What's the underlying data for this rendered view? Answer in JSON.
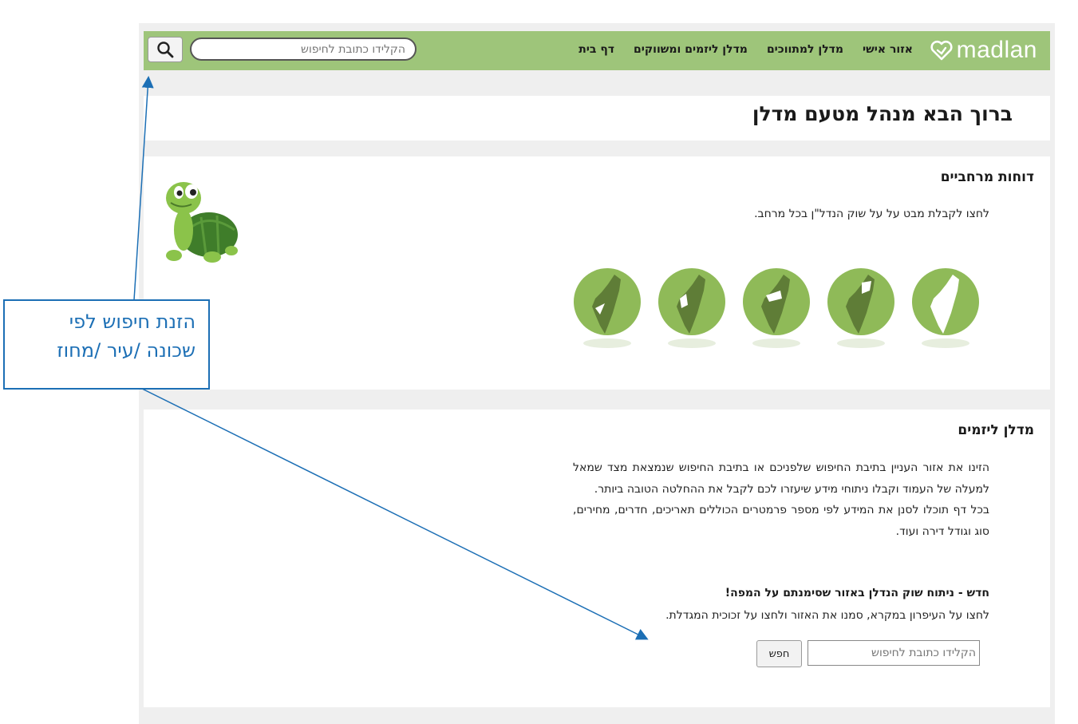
{
  "nav": {
    "logo_text": "madlan",
    "links": [
      "דף בית",
      "מדלן ליזמים ומשווקים",
      "מדלן למתווכים",
      "אזור אישי"
    ],
    "search_placeholder": "הקלידו כתובת לחיפוש"
  },
  "welcome": {
    "title": "ברוך הבא מנהל מטעם מדלן"
  },
  "regional": {
    "title": "דוחות מרחביים",
    "description": "לחצו לקבלת מבט על על שוק הנדל\"ן בכל מרחב."
  },
  "developers": {
    "title": "מדלן ליזמים",
    "paragraph1": "הזינו את אזור העניין בתיבת החיפוש שלפניכם או בתיבת החיפוש שנמצאת מצד שמאל למעלה של העמוד וקבלו ניתוחי מידע שיעזרו לכם לקבל את ההחלטה הטובה ביותר.",
    "paragraph2": "בכל דף תוכלו לסנן את המידע לפי מספר פרמטרים הכוללים תאריכים, חדרים, מחירים, סוג וגודל דירה ועוד.",
    "new_title": "חדש - ניתוח שוק הנדלן באזור שסימנתם על המפה!",
    "new_desc": "לחצו על העיפרון במקרא, סמנו את האזור ולחצו על זכוכית המגדלת.",
    "search_placeholder": "הקלידו כתובת לחיפוש",
    "search_button": "חפש"
  },
  "callout": {
    "line1": "הזנת חיפוש לפי",
    "line2": "שכונה /עיר /מחוז"
  },
  "colors": {
    "nav_green": "#9ec57a",
    "map_green": "#8fba58",
    "map_dark": "#5f7d37",
    "callout_blue": "#1c6fb5"
  },
  "icons": [
    "search-icon",
    "heart-logo-icon",
    "turtle-mascot",
    "region-map-icon"
  ]
}
